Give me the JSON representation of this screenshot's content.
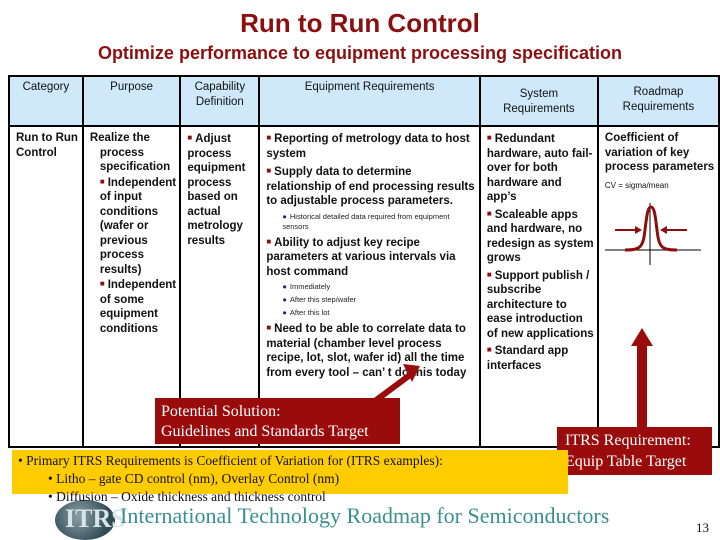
{
  "title": "Run to Run Control",
  "subtitle": "Optimize performance to equipment processing specification",
  "table": {
    "headers": [
      "Category",
      "Purpose",
      "Capability Definition",
      "Equipment Requirements",
      "System Requirements",
      "Roadmap Requirements"
    ],
    "category": "Run to Run Control",
    "purpose": {
      "lead": "Realize the process specification",
      "bullets": [
        "Independent of input conditions (wafer or previous process results)",
        "Independent of some equipment conditions"
      ]
    },
    "capability": [
      "Adjust process equipment process based on actual metrology results"
    ],
    "equipment": {
      "items": [
        {
          "text": "Reporting of metrology data to host system",
          "subs": []
        },
        {
          "text": "Supply data to determine relationship of end processing results to adjustable process parameters.",
          "subs": [
            "Historical detailed data required from equipment sensors"
          ]
        },
        {
          "text": "Ability to adjust key recipe parameters at various intervals via host command",
          "subs": [
            "Immediately",
            "After this step/wafer",
            "After this lot"
          ]
        },
        {
          "text": "Need to be able to correlate data to material (chamber level process recipe, lot, slot, wafer id) all the time from every tool – can’ t do this today",
          "subs": []
        }
      ]
    },
    "system": [
      "Redundant hardware, auto fail-over for both hardware and app’s",
      "Scaleable apps and hardware, no redesign as system grows",
      "Support publish / subscribe architecture to ease introduction of new applications",
      "Standard app interfaces"
    ],
    "roadmap": {
      "text": "Coefficient of variation of key process parameters",
      "formula": "CV = sigma/mean"
    }
  },
  "callouts": {
    "left": [
      "Potential Solution:",
      "Guidelines and Standards Target"
    ],
    "right": [
      "ITRS Requirement:",
      "Equip Table Target"
    ]
  },
  "note": {
    "line1": "• Primary ITRS Requirements is Coefficient of Variation for (ITRS examples):",
    "line2": "• Litho – gate CD control (nm), Overlay Control (nm)",
    "line3": "• Diffusion – Oxide thickness and thickness control"
  },
  "footer": {
    "logo": "ITRS",
    "text": "International Technology Roadmap for Semiconductors",
    "page": "13"
  },
  "colors": {
    "accent": "#9a0c0c",
    "header_bg": "#cfe9fb",
    "note_bg": "#ffcc00"
  }
}
